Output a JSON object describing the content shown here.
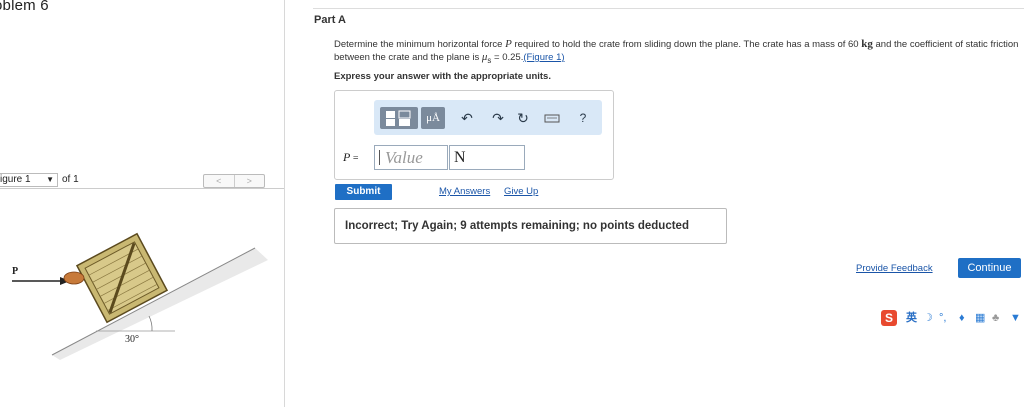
{
  "page": {
    "title_fragment": "oblem 6"
  },
  "figure_nav": {
    "select_value": "igure 1",
    "of_label": "of 1",
    "prev": "<",
    "next": ">",
    "force_label": "P",
    "angle_label": "30°"
  },
  "part": {
    "title": "Part A"
  },
  "problem": {
    "text_1": "Determine the minimum horizontal force ",
    "var_p": "P",
    "text_2": " required to hold the crate from sliding down the plane. The crate has a mass of 60 ",
    "unit_kg": "kg",
    "text_3": " and the coefficient of static friction between the crate and the plane is ",
    "mu": "μ",
    "mu_sub": "s",
    "text_4": " = 0.25.",
    "figure_link": "(Figure 1)",
    "instruction": "Express your answer with the appropriate units."
  },
  "answer": {
    "units_btn": "μÅ",
    "label_var": "P",
    "label_eq": " =",
    "value_placeholder": "Value",
    "unit_value": "N",
    "help_icon": "?"
  },
  "actions": {
    "submit": "Submit",
    "my_answers": "My Answers",
    "give_up": "Give Up",
    "feedback": "Incorrect; Try Again; 9 attempts remaining; no points deducted",
    "provide_feedback": "Provide Feedback",
    "continue": "Continue"
  },
  "ime": {
    "logo": "S",
    "lang": "英"
  },
  "colors": {
    "accent": "#1f6fc5",
    "toolbar_bg": "#d9e8f7",
    "link": "#1a55a8",
    "ime_red": "#e8492f"
  }
}
